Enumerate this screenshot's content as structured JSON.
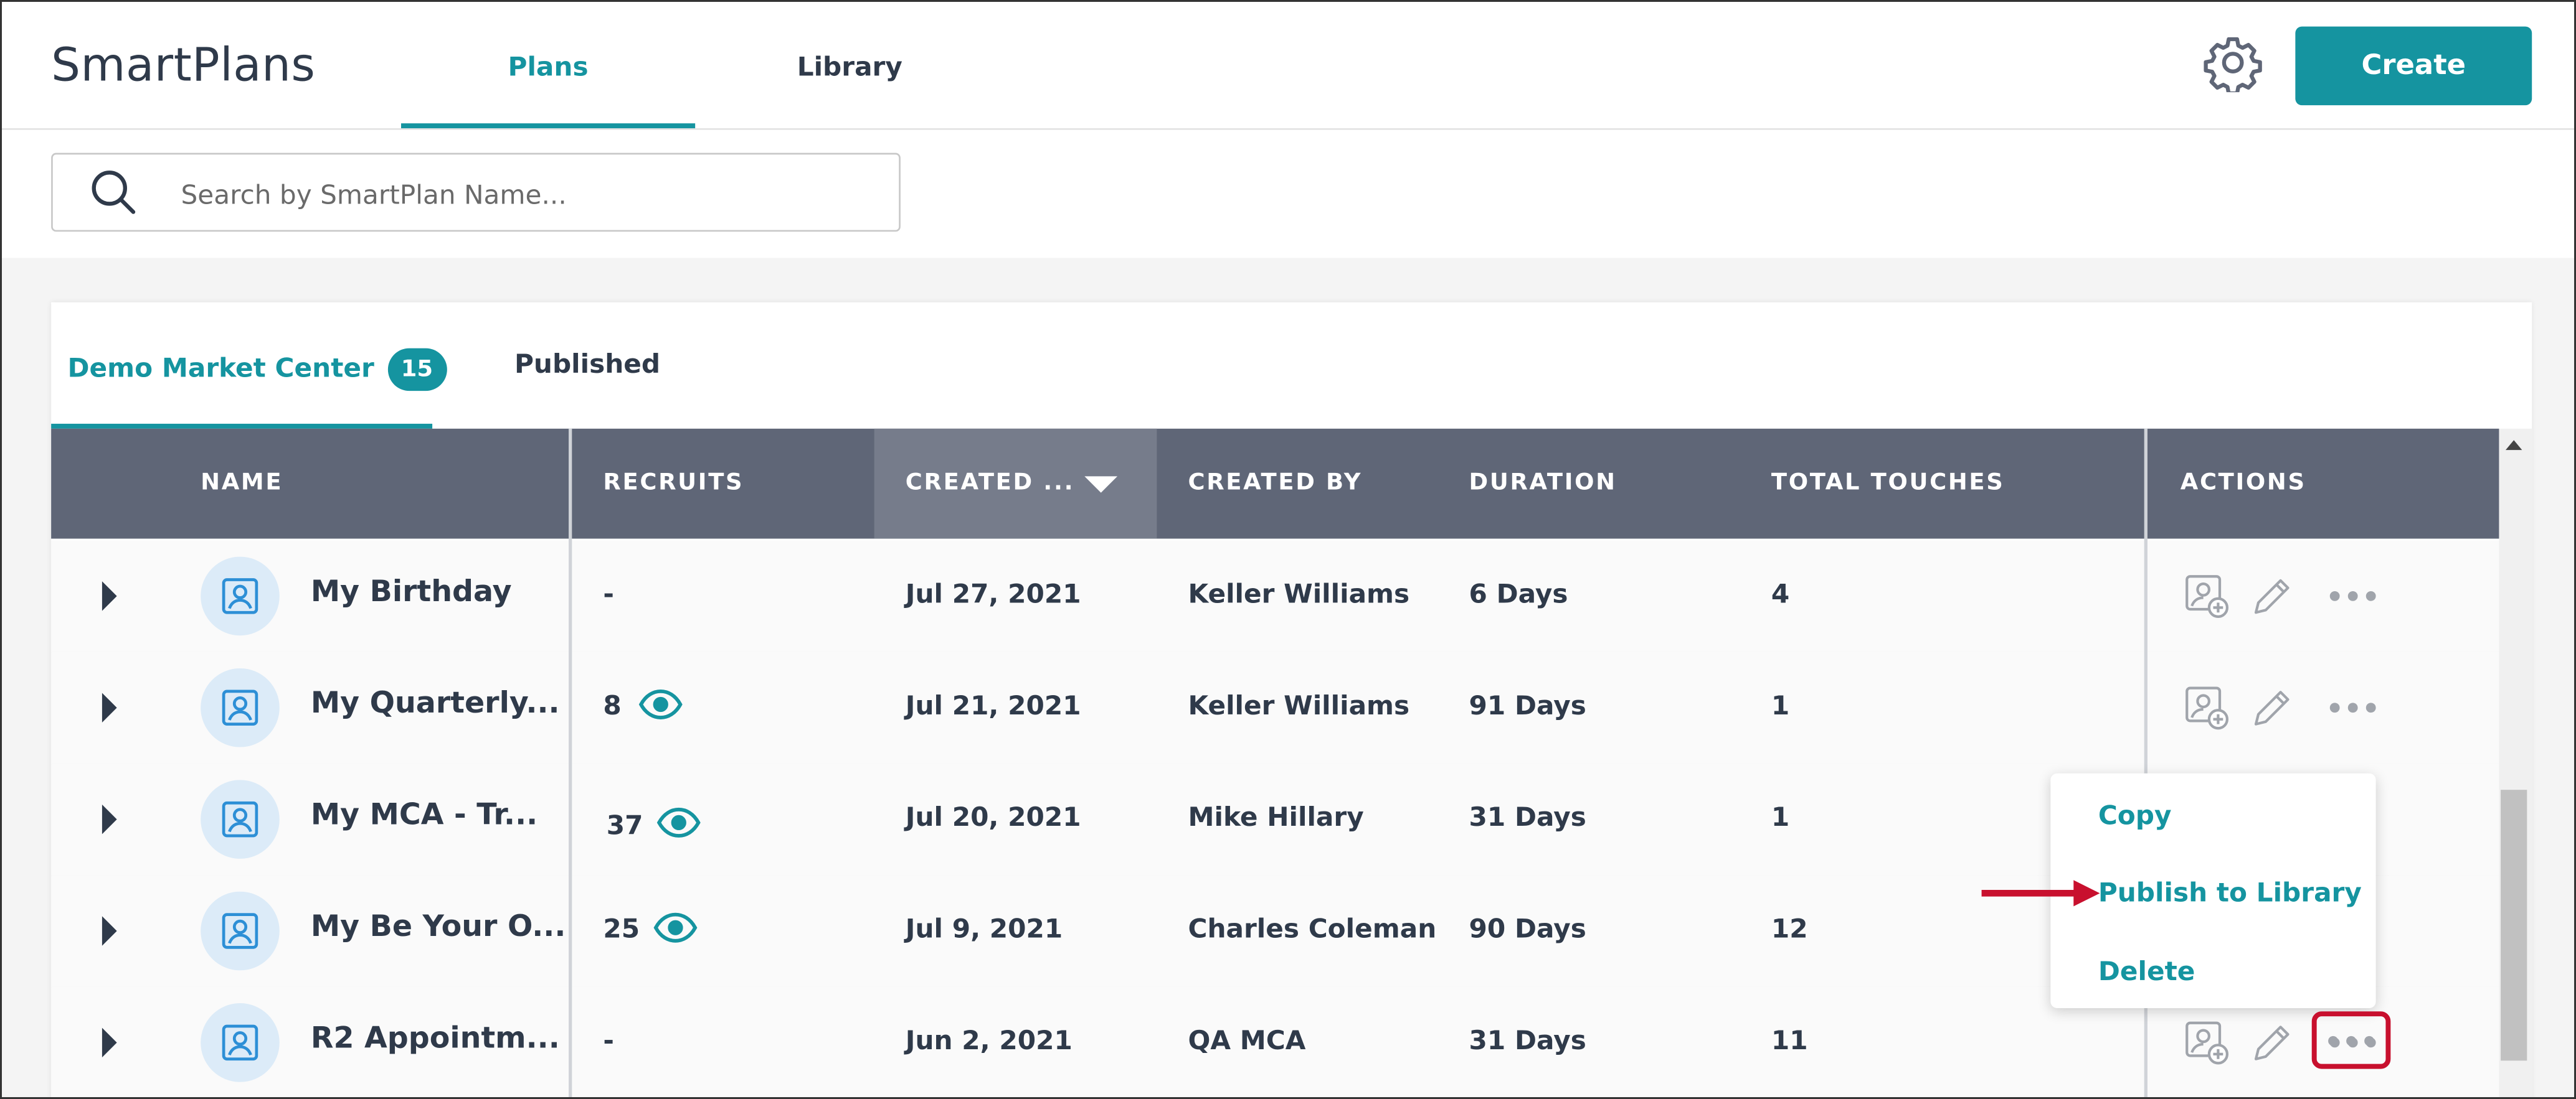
{
  "header": {
    "app_title": "SmartPlans",
    "tabs": [
      {
        "label": "Plans",
        "active": true
      },
      {
        "label": "Library",
        "active": false
      }
    ],
    "settings_icon": "gear-icon",
    "create_label": "Create"
  },
  "search": {
    "placeholder": "Search by SmartPlan Name...",
    "value": ""
  },
  "subtabs": {
    "demo_label": "Demo Market Center",
    "demo_count": "15",
    "published_label": "Published"
  },
  "table": {
    "columns": {
      "name": "NAME",
      "recruits": "RECRUITS",
      "created": "CREATED ...",
      "created_by": "CREATED BY",
      "duration": "DURATION",
      "touches": "TOTAL TOUCHES",
      "actions": "ACTIONS"
    },
    "sort_column": "created",
    "sort_direction": "descending",
    "rows": [
      {
        "name": "My Birthday",
        "recruits": "-",
        "created": "Jul 27, 2021",
        "created_by": "Keller Williams",
        "duration": "6 Days",
        "touches": "4"
      },
      {
        "name": "My Quarterly...",
        "recruits": "8",
        "created": "Jul 21, 2021",
        "created_by": "Keller Williams",
        "duration": "91 Days",
        "touches": "1"
      },
      {
        "name": "My MCA - Tr...",
        "recruits": "37",
        "created": "Jul 20, 2021",
        "created_by": "Mike Hillary",
        "duration": "31 Days",
        "touches": "1"
      },
      {
        "name": "My Be Your O...",
        "recruits": "25",
        "created": "Jul 9, 2021",
        "created_by": "Charles Coleman",
        "duration": "90 Days",
        "touches": "12"
      },
      {
        "name": "R2 Appointm...",
        "recruits": "-",
        "created": "Jun 2, 2021",
        "created_by": "QA MCA",
        "duration": "31 Days",
        "touches": "11"
      }
    ]
  },
  "action_menu": {
    "items": [
      "Copy",
      "Publish to Library",
      "Delete"
    ]
  },
  "colors": {
    "accent": "#1594a0",
    "header_bg": "#5f6677",
    "highlight": "#c8102e"
  }
}
